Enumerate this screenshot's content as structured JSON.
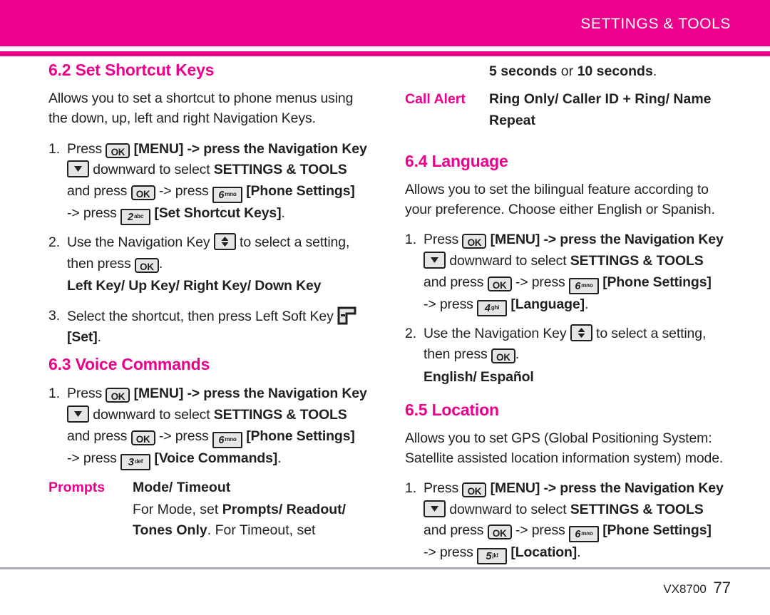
{
  "header": {
    "title": "SETTINGS & TOOLS",
    "accent_color": "#ec008c",
    "text_color": "#ffffff"
  },
  "footer": {
    "model": "VX8700",
    "page_number": "77"
  },
  "icons": {
    "ok_key": "OK",
    "key_2": "2",
    "key_2_letters": "abc",
    "key_3": "3",
    "key_3_letters": "def",
    "key_4": "4",
    "key_4_letters": "ghi",
    "key_5": "5",
    "key_5_letters": "jkl",
    "key_6": "6",
    "key_6_letters": "mno"
  },
  "left_column": {
    "section_62": {
      "heading": "6.2 Set Shortcut Keys",
      "intro": "Allows you to set a shortcut to phone menus using the down, up, left and right Navigation Keys.",
      "step1": {
        "num": "1.",
        "t1": "Press",
        "t2": "[MENU] -> press the Navigation Key",
        "t3": "downward to select",
        "t4": "SETTINGS & TOOLS",
        "t5": "and press",
        "t6": "-> press",
        "t7": "[Phone Settings]",
        "t8": "-> press",
        "t9": "[Set Shortcut Keys]",
        "t10": "."
      },
      "step2": {
        "num": "2.",
        "t1": "Use the Navigation Key",
        "t2": "to select a setting,",
        "t3": "then press",
        "t4": ".",
        "options": "Left Key/ Up Key/ Right Key/ Down Key"
      },
      "step3": {
        "num": "3.",
        "t1": "Select the shortcut, then press Left Soft Key",
        "t2": "[Set]",
        "t3": "."
      }
    },
    "section_63": {
      "heading": "6.3 Voice Commands",
      "step1": {
        "num": "1.",
        "t1": "Press",
        "t2": "[MENU] -> press the Navigation Key",
        "t3": "downward to select",
        "t4": "SETTINGS & TOOLS",
        "t5": "and press",
        "t6": "-> press",
        "t7": "[Phone Settings]",
        "t8": "-> press",
        "t9": "[Voice Commands]",
        "t10": "."
      },
      "prompts_row": {
        "term": "Prompts",
        "desc": "Mode/ Timeout"
      },
      "prompts_detail_1a": "For Mode, set ",
      "prompts_detail_1b": "Prompts/ Readout/",
      "prompts_detail_2a": "Tones Only",
      "prompts_detail_2b": ". For Timeout, set"
    }
  },
  "right_column": {
    "continued": {
      "a": "5 seconds",
      "b": " or ",
      "c": "10 seconds",
      "d": "."
    },
    "call_alert_row": {
      "term": "Call Alert",
      "desc": "Ring Only/ Caller ID + Ring/ Name Repeat"
    },
    "section_64": {
      "heading": "6.4 Language",
      "intro": "Allows you to set the bilingual feature according to your preference. Choose either English or Spanish.",
      "step1": {
        "num": "1.",
        "t1": "Press",
        "t2": "[MENU] -> press the Navigation Key",
        "t3": "downward to select",
        "t4": "SETTINGS & TOOLS",
        "t5": "and press",
        "t6": "-> press",
        "t7": "[Phone Settings]",
        "t8": "-> press",
        "t9": "[Language]",
        "t10": "."
      },
      "step2": {
        "num": "2.",
        "t1": "Use the Navigation Key",
        "t2": "to select a setting,",
        "t3": "then press",
        "t4": ".",
        "options": "English/ Español"
      }
    },
    "section_65": {
      "heading": "6.5 Location",
      "intro": "Allows you to set GPS (Global Positioning System: Satellite assisted location information system) mode.",
      "step1": {
        "num": "1.",
        "t1": "Press",
        "t2": "[MENU] -> press the Navigation Key",
        "t3": "downward to select",
        "t4": "SETTINGS & TOOLS",
        "t5": "and press",
        "t6": "-> press",
        "t7": "[Phone Settings]",
        "t8": "-> press",
        "t9": "[Location]",
        "t10": "."
      }
    }
  }
}
